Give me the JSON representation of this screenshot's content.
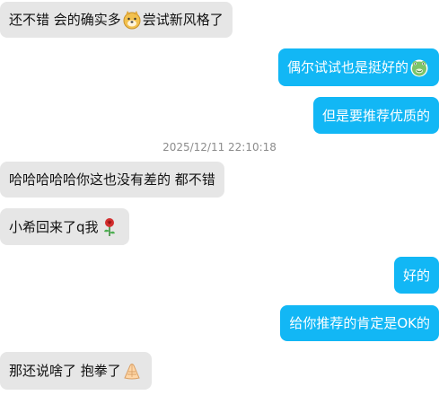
{
  "messages": [
    {
      "side": "left",
      "parts": [
        "还不错 会的确实多",
        "尝试新风格了"
      ],
      "emoji": "doge-face-icon"
    },
    {
      "side": "right",
      "parts": [
        "偶尔试试也是挺好的"
      ],
      "emoji": "green-frog-face-icon"
    },
    {
      "side": "right",
      "parts": [
        "但是要推荐优质的"
      ]
    },
    {
      "side": "left",
      "parts": [
        "哈哈哈哈哈你这也没有差的 都不错"
      ]
    },
    {
      "side": "left",
      "parts": [
        "小希回来了q我"
      ],
      "emoji": "rose-icon"
    },
    {
      "side": "right",
      "parts": [
        "好的"
      ]
    },
    {
      "side": "right",
      "parts": [
        "给你推荐的肯定是OK的"
      ]
    },
    {
      "side": "left",
      "parts": [
        "那还说啥了 抱拳了"
      ],
      "emoji": "fist-salute-icon"
    }
  ],
  "timestamp": "2025/12/11 22:10:18",
  "colors": {
    "left_bubble": "#e6e6e6",
    "right_bubble": "#12b7f5",
    "timestamp": "#8c8c8c"
  }
}
